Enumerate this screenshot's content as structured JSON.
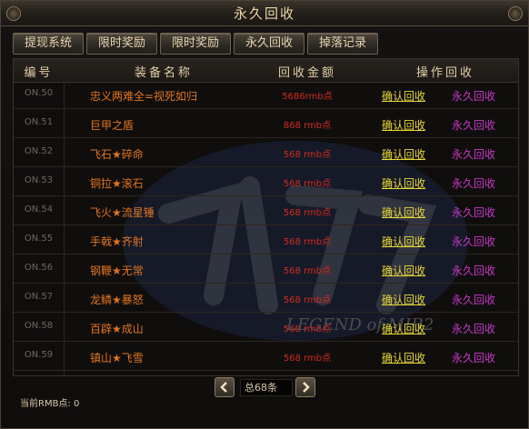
{
  "window": {
    "title": "永久回收"
  },
  "tabs": [
    {
      "label": "提现系统"
    },
    {
      "label": "限时奖励"
    },
    {
      "label": "限时奖励"
    },
    {
      "label": "永久回收"
    },
    {
      "label": "掉落记录"
    }
  ],
  "table": {
    "headers": [
      "编号",
      "装备名称",
      "回收金额",
      "操作回收"
    ],
    "rows": [
      {
        "id": "ON.50",
        "name": "忠义两难全=视死如归",
        "price": "5686rmb点",
        "confirm": "确认回收",
        "perm": "永久回收"
      },
      {
        "id": "ON.51",
        "name": "巨甲之盾",
        "price": "868 rmb点",
        "confirm": "确认回收",
        "perm": "永久回收"
      },
      {
        "id": "ON.52",
        "name": "飞石★碎命",
        "price": "568 rmb点",
        "confirm": "确认回收",
        "perm": "永久回收"
      },
      {
        "id": "ON.53",
        "name": "铜拉★滚石",
        "price": "568 rmb点",
        "confirm": "确认回收",
        "perm": "永久回收"
      },
      {
        "id": "ON.54",
        "name": "飞火★流星锤",
        "price": "568 rmb点",
        "confirm": "确认回收",
        "perm": "永久回收"
      },
      {
        "id": "ON.55",
        "name": "手戟★齐射",
        "price": "568 rmb点",
        "confirm": "确认回收",
        "perm": "永久回收"
      },
      {
        "id": "ON.56",
        "name": "钢鞭★无常",
        "price": "568 rmb点",
        "confirm": "确认回收",
        "perm": "永久回收"
      },
      {
        "id": "ON.57",
        "name": "龙鳞★暴怒",
        "price": "568 rmb点",
        "confirm": "确认回收",
        "perm": "永久回收"
      },
      {
        "id": "ON.58",
        "name": "百辟★成山",
        "price": "568 rmb点",
        "confirm": "确认回收",
        "perm": "永久回收"
      },
      {
        "id": "ON.59",
        "name": "镇山★飞雪",
        "price": "568 rmb点",
        "confirm": "确认回收",
        "perm": "永久回收"
      }
    ]
  },
  "watermark": {
    "text": "LEGEND of MIR2"
  },
  "pager": {
    "total": "总68条",
    "prev_icon": "arrow-left-icon",
    "next_icon": "arrow-right-icon"
  },
  "footer": {
    "balance": "当前RMB点: 0"
  },
  "colors": {
    "item_name": "#e2741f",
    "price": "#d02a20",
    "confirm": "#e8d838",
    "perm": "#c838c8"
  }
}
